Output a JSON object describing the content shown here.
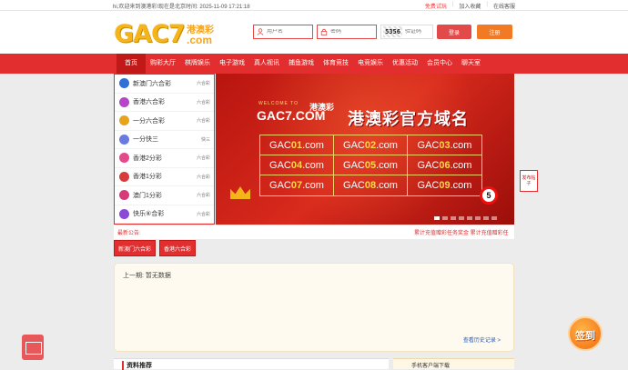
{
  "topbar": {
    "welcome": "hi,欢迎来到澳港彩!现在是北京时间: 2025-11-09 17:21:18",
    "free_trial": "免费试玩",
    "favorite": "加入收藏",
    "online_customer": "在线客服"
  },
  "logo": {
    "main": "GAC7",
    "cn": "港澳彩",
    "com": ".com"
  },
  "login": {
    "username_placeholder": "用户名",
    "password_placeholder": "密码",
    "captcha_code": "5356",
    "captcha_placeholder": "验证码",
    "login_label": "登录",
    "register_label": "注册"
  },
  "nav": {
    "items": [
      "首页",
      "购彩大厅",
      "棋牌娱乐",
      "电子游戏",
      "真人视讯",
      "捕鱼游戏",
      "体育竞技",
      "电竞娱乐",
      "优惠活动",
      "会员中心",
      "聊天室"
    ]
  },
  "lottery": {
    "items": [
      {
        "name": "新澳门六合彩",
        "tag": "六合彩",
        "color": "#2f6fd6"
      },
      {
        "name": "香港六合彩",
        "tag": "六合彩",
        "color": "#b844c9"
      },
      {
        "name": "一分六合彩",
        "tag": "六合彩",
        "color": "#e8a21c"
      },
      {
        "name": "一分快三",
        "tag": "快三",
        "color": "#6a7be0"
      },
      {
        "name": "香港2分彩",
        "tag": "六合彩",
        "color": "#e24a8a"
      },
      {
        "name": "香港1分彩",
        "tag": "六合彩",
        "color": "#d93a3a"
      },
      {
        "name": "澳门1分彩",
        "tag": "六合彩",
        "color": "#d93a7a"
      },
      {
        "name": "快乐⑥合彩",
        "tag": "六合彩",
        "color": "#8a4ad6"
      }
    ]
  },
  "banner": {
    "welcome": "WELCOME TO",
    "logo": "GAC7.COM",
    "logo_cn": "港澳彩",
    "title": "港澳彩官方域名",
    "domains": [
      {
        "pre": "GAC",
        "num": "01",
        "suf": ".com"
      },
      {
        "pre": "GAC",
        "num": "02",
        "suf": ".com"
      },
      {
        "pre": "GAC",
        "num": "03",
        "suf": ".com"
      },
      {
        "pre": "GAC",
        "num": "04",
        "suf": ".com"
      },
      {
        "pre": "GAC",
        "num": "05",
        "suf": ".com"
      },
      {
        "pre": "GAC",
        "num": "06",
        "suf": ".com"
      },
      {
        "pre": "GAC",
        "num": "07",
        "suf": ".com"
      },
      {
        "pre": "GAC",
        "num": "08",
        "suf": ".com"
      },
      {
        "pre": "GAC",
        "num": "09",
        "suf": ".com"
      }
    ],
    "ball_number": "5"
  },
  "side_badge": "发布帖子",
  "notice": {
    "label": "最新公告:",
    "text": "累计充值赠彩任务奖金 累计充值赠彩任"
  },
  "tabs": [
    "新澳门六合彩",
    "香港六合彩"
  ],
  "history": {
    "last_label": "上一期: 暂无数据",
    "more_label": "查看历史记录 >"
  },
  "sections": {
    "materials": "资料推荐",
    "app_download": "手机客户端下载"
  },
  "checkin": "签到"
}
